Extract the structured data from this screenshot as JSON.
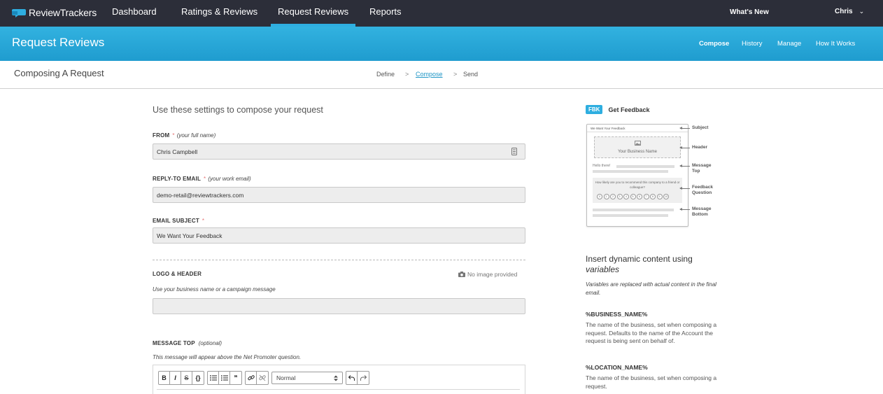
{
  "topnav": {
    "brand": "ReviewTrackers",
    "items": [
      {
        "label": "Dashboard",
        "active": false
      },
      {
        "label": "Ratings & Reviews",
        "active": false
      },
      {
        "label": "Request Reviews",
        "active": true
      },
      {
        "label": "Reports",
        "active": false
      }
    ],
    "whats_new": "What's New",
    "user": "Chris",
    "user_chevron": "⌄"
  },
  "header": {
    "title": "Request Reviews",
    "subnav": [
      {
        "label": "Compose",
        "active": true
      },
      {
        "label": "History",
        "active": false
      },
      {
        "label": "Manage",
        "active": false
      },
      {
        "label": "How It Works",
        "active": false
      }
    ]
  },
  "composer": {
    "title": "Composing A Request",
    "steps": [
      {
        "label": "Define",
        "active": false
      },
      {
        "label": "Compose",
        "active": true
      },
      {
        "label": "Send",
        "active": false
      }
    ],
    "separator": ">"
  },
  "form": {
    "title": "Use these settings to compose your request",
    "from": {
      "label": "FROM",
      "required": "*",
      "hint": "(your full name)",
      "value": "Chris Campbell"
    },
    "reply_to": {
      "label": "REPLY-TO EMAIL",
      "required": "*",
      "hint": "(your work email)",
      "value": "demo-retail@reviewtrackers.com"
    },
    "subject": {
      "label": "EMAIL SUBJECT",
      "required": "*",
      "value": "We Want Your Feedback"
    },
    "logo": {
      "label": "LOGO & HEADER",
      "note": "Use your business name or a campaign message",
      "no_image": "No image provided",
      "value": ""
    },
    "message_top": {
      "label": "MESSAGE TOP",
      "hint": "(optional)",
      "note": "This message will appear above the Net Promoter question."
    },
    "toolbar": {
      "bold": "B",
      "italic": "I",
      "strike": "S",
      "code": "{}",
      "quote": "❞",
      "format_select": "Normal"
    }
  },
  "preview": {
    "badge": "FBK",
    "title": "Get Feedback",
    "subject_text": "We Want Your Feedback",
    "business_name": "Your Business Name",
    "hello": "Hello there!",
    "question": "How likely are you to recommend this company to a friend or colleague?",
    "scale": [
      "0",
      "1",
      "2",
      "3",
      "4",
      "5",
      "6",
      "7",
      "8",
      "9",
      "10"
    ],
    "callouts": {
      "subject": "Subject",
      "header": "Header",
      "message_top": "Message Top",
      "feedback_question": "Feedback Question",
      "message_bottom": "Message Bottom"
    }
  },
  "variables": {
    "heading": "Insert dynamic content using",
    "heading_em": "variables",
    "note": "Variables are replaced with actual content in the final email.",
    "items": [
      {
        "name": "%BUSINESS_NAME%",
        "desc": "The name of the business, set when composing a request. Defaults to the name of the Account the request is being sent on behalf of."
      },
      {
        "name": "%LOCATION_NAME%",
        "desc": "The name of the business, set when composing a request."
      }
    ]
  },
  "colors": {
    "nav_bg": "#2c2e39",
    "accent": "#2eaee0",
    "link": "#2096c6",
    "required": "#e57373"
  }
}
